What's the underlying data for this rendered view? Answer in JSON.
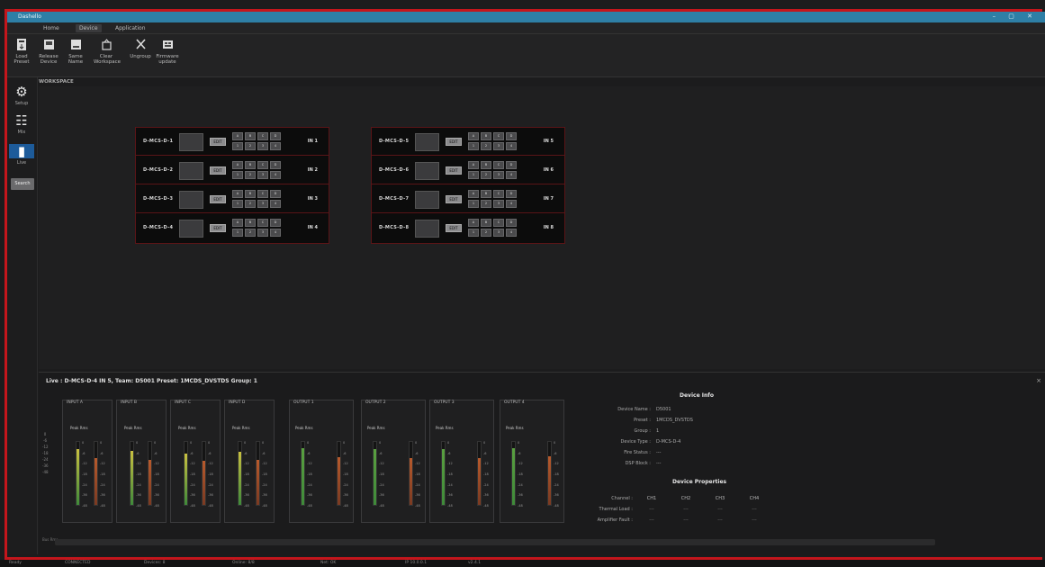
{
  "window": {
    "title": "Dashello",
    "controls": "– ▢ ✕"
  },
  "menu_tabs": [
    "Home",
    "Device",
    "Application"
  ],
  "menu_active": 1,
  "ribbon": [
    {
      "label1": "Load",
      "label2": "Preset",
      "icon": "load-preset-icon"
    },
    {
      "label1": "Release",
      "label2": "Device",
      "icon": "release-device-icon"
    },
    {
      "label1": "Same",
      "label2": "Name",
      "icon": "same-name-icon"
    },
    {
      "label1": "Clear",
      "label2": "Workspace",
      "icon": "clear-workspace-icon"
    },
    {
      "label1": "Ungroup",
      "label2": "",
      "icon": "ungroup-icon"
    },
    {
      "label1": "Firmware",
      "label2": "update",
      "icon": "firmware-update-icon"
    }
  ],
  "workspace_label": "WORKSPACE",
  "sidebar": [
    {
      "label": "Setup",
      "icon": "gear-icon"
    },
    {
      "label": "Mix",
      "icon": "mixer-icon"
    },
    {
      "label": "Live",
      "icon": "meter-icon"
    }
  ],
  "sidebar_search": "Search",
  "device_groups": [
    {
      "devices": [
        {
          "name": "D-MCS-D-1",
          "button": "EDIT",
          "cells": [
            "A",
            "B",
            "C",
            "D",
            "1",
            "2",
            "3",
            "4"
          ],
          "num": "IN 1"
        },
        {
          "name": "D-MCS-D-2",
          "button": "EDIT",
          "cells": [
            "A",
            "B",
            "C",
            "D",
            "1",
            "2",
            "3",
            "4"
          ],
          "num": "IN 2"
        },
        {
          "name": "D-MCS-D-3",
          "button": "EDIT",
          "cells": [
            "A",
            "B",
            "C",
            "D",
            "1",
            "2",
            "3",
            "4"
          ],
          "num": "IN 3"
        },
        {
          "name": "D-MCS-D-4",
          "button": "EDIT",
          "cells": [
            "A",
            "B",
            "C",
            "D",
            "1",
            "2",
            "3",
            "4"
          ],
          "num": "IN 4"
        }
      ]
    },
    {
      "devices": [
        {
          "name": "D-MCS-D-5",
          "button": "EDIT",
          "cells": [
            "A",
            "B",
            "C",
            "D",
            "1",
            "2",
            "3",
            "4"
          ],
          "num": "IN 5"
        },
        {
          "name": "D-MCS-D-6",
          "button": "EDIT",
          "cells": [
            "A",
            "B",
            "C",
            "D",
            "1",
            "2",
            "3",
            "4"
          ],
          "num": "IN 6"
        },
        {
          "name": "D-MCS-D-7",
          "button": "EDIT",
          "cells": [
            "A",
            "B",
            "C",
            "D",
            "1",
            "2",
            "3",
            "4"
          ],
          "num": "IN 7"
        },
        {
          "name": "D-MCS-D-8",
          "button": "EDIT",
          "cells": [
            "A",
            "B",
            "C",
            "D",
            "1",
            "2",
            "3",
            "4"
          ],
          "num": "IN 8"
        }
      ]
    }
  ],
  "live": {
    "header": "Live :   D-MCS-D-4  IN 5,  Team: D5001   Preset: 1MCDS_DVSTDS   Group: 1",
    "close": "×",
    "scale": [
      "0",
      "-6",
      "-12",
      "-18",
      "-24",
      "-36",
      "-48"
    ],
    "meters": [
      {
        "title": "INPUT A",
        "label": "Peak  Rms",
        "levels": [
          0.88,
          0.74
        ],
        "colors": [
          "#c8c040",
          "#b85a2c"
        ]
      },
      {
        "title": "INPUT B",
        "label": "Peak  Rms",
        "levels": [
          0.86,
          0.72
        ],
        "colors": [
          "#c8c040",
          "#b85a2c"
        ]
      },
      {
        "title": "INPUT C",
        "label": "Peak  Rms",
        "levels": [
          0.82,
          0.7
        ],
        "colors": [
          "#c8c040",
          "#b85a2c"
        ]
      },
      {
        "title": "INPUT D",
        "label": "Peak  Rms",
        "levels": [
          0.84,
          0.71
        ],
        "colors": [
          "#c8c040",
          "#b85a2c"
        ]
      },
      {
        "title": "OUTPUT 1",
        "label": "Peak        Rms",
        "levels": [
          0.9,
          0.76
        ],
        "colors": [
          "#5aa040",
          "#b85a2c"
        ]
      },
      {
        "title": "OUTPUT 2",
        "label": "Peak        Rms",
        "levels": [
          0.88,
          0.74
        ],
        "colors": [
          "#5aa040",
          "#b85a2c"
        ]
      },
      {
        "title": "OUTPUT 3",
        "label": "Peak        Rms",
        "levels": [
          0.89,
          0.75
        ],
        "colors": [
          "#5aa040",
          "#b85a2c"
        ]
      },
      {
        "title": "OUTPUT 4",
        "label": "Peak        Rms",
        "levels": [
          0.9,
          0.77
        ],
        "colors": [
          "#5aa040",
          "#b85a2c"
        ]
      }
    ],
    "ticks": [
      "0",
      "-6",
      "-12",
      "-18",
      "-24",
      "-36",
      "-48"
    ],
    "bottom_label": "Bus\nRms",
    "device_info": {
      "title": "Device Info",
      "rows": [
        {
          "k": "Device Name :",
          "v": "D5001"
        },
        {
          "k": "Preset :",
          "v": "1MCDS_DVSTDS"
        },
        {
          "k": "Group :",
          "v": "1"
        },
        {
          "k": "Device Type :",
          "v": "D-MCS-D-4"
        },
        {
          "k": "Fire Status :",
          "v": "---"
        },
        {
          "k": "DSP Block :",
          "v": "---"
        }
      ]
    },
    "device_props": {
      "title": "Device Properties",
      "channels_label": "Channel :",
      "channels": [
        "CH1",
        "CH2",
        "CH3",
        "CH4"
      ],
      "rows": [
        {
          "k": "Thermal Load :",
          "vals": [
            "---",
            "---",
            "---",
            "---"
          ]
        },
        {
          "k": "Amplifier Fault :",
          "vals": [
            "---",
            "---",
            "---",
            "---"
          ]
        }
      ]
    }
  },
  "statusbar": [
    "Ready",
    "CONNECTED",
    "Devices: 8",
    "Online: 8/8",
    "Net: OK",
    "IP 10.0.0.1",
    "v2.4.1"
  ]
}
